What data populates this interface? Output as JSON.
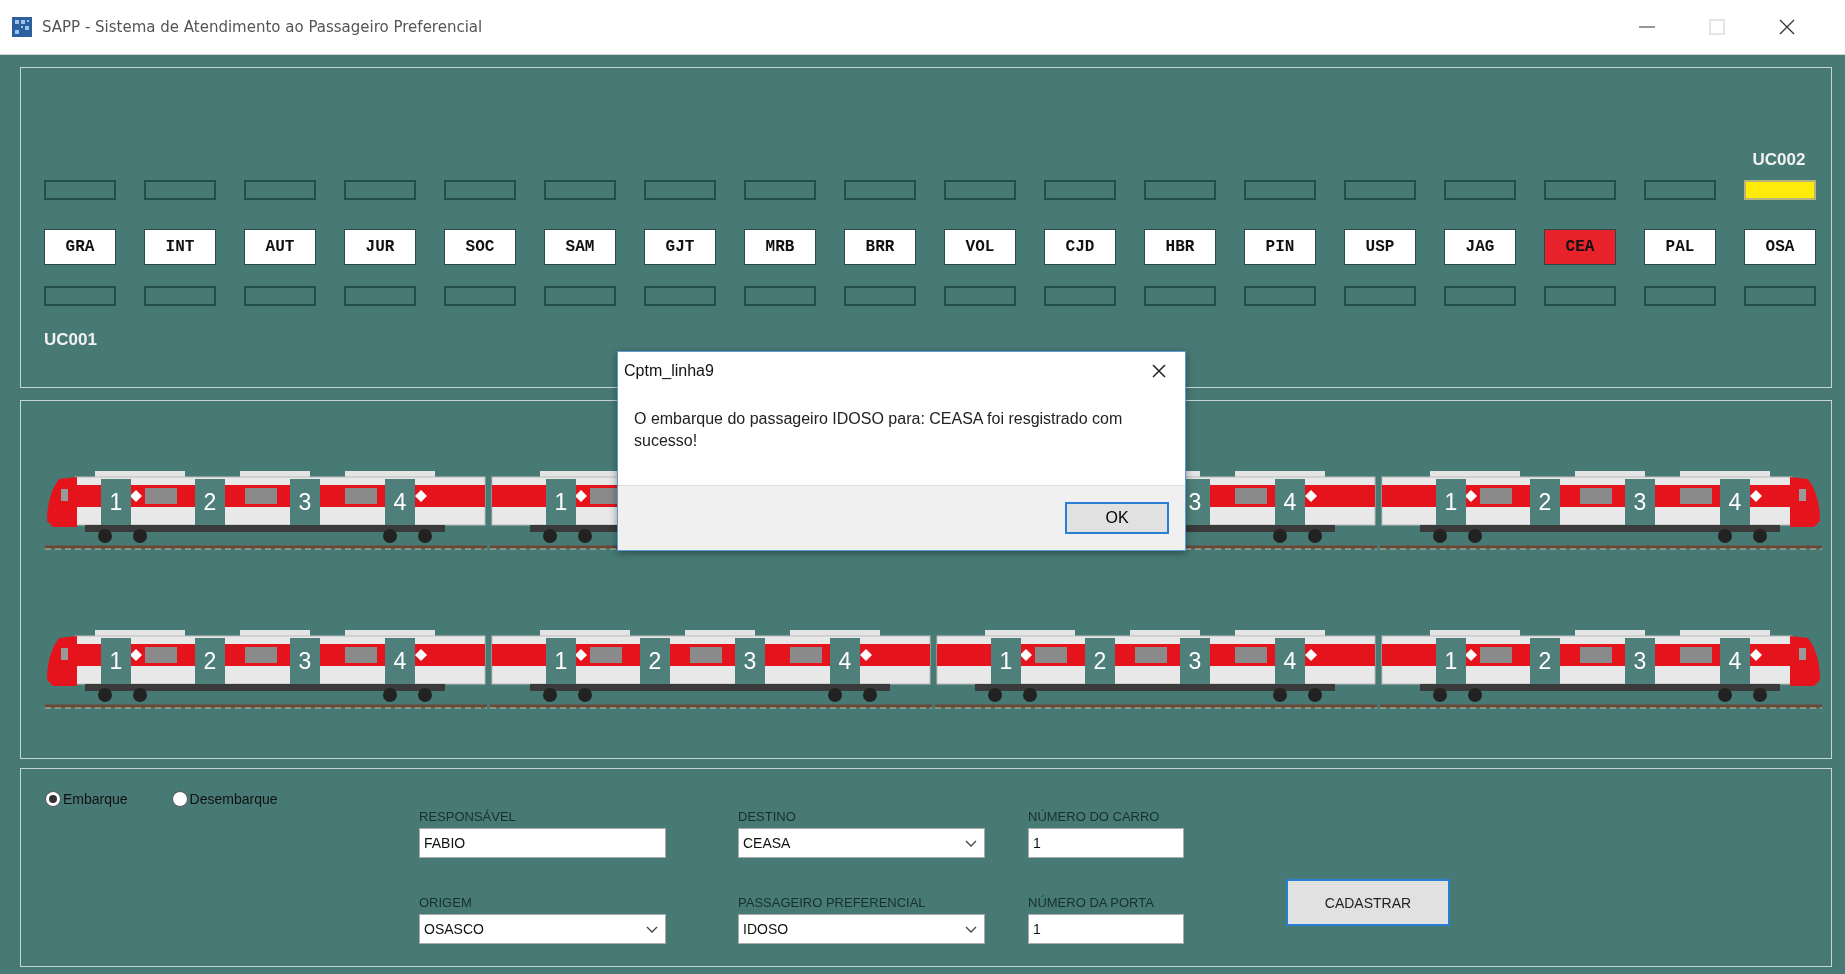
{
  "window": {
    "title": "SAPP - Sistema de Atendimento ao Passageiro Preferencial"
  },
  "line_panel": {
    "top_label": "UC002",
    "bottom_label": "UC001",
    "stations": [
      {
        "code": "GRA",
        "selected": false,
        "top_on": false,
        "bottom_on": false
      },
      {
        "code": "INT",
        "selected": false,
        "top_on": false,
        "bottom_on": false
      },
      {
        "code": "AUT",
        "selected": false,
        "top_on": false,
        "bottom_on": false
      },
      {
        "code": "JUR",
        "selected": false,
        "top_on": false,
        "bottom_on": false
      },
      {
        "code": "SOC",
        "selected": false,
        "top_on": false,
        "bottom_on": false
      },
      {
        "code": "SAM",
        "selected": false,
        "top_on": false,
        "bottom_on": false
      },
      {
        "code": "GJT",
        "selected": false,
        "top_on": false,
        "bottom_on": false
      },
      {
        "code": "MRB",
        "selected": false,
        "top_on": false,
        "bottom_on": false
      },
      {
        "code": "BRR",
        "selected": false,
        "top_on": false,
        "bottom_on": false
      },
      {
        "code": "VOL",
        "selected": false,
        "top_on": false,
        "bottom_on": false
      },
      {
        "code": "CJD",
        "selected": false,
        "top_on": false,
        "bottom_on": false
      },
      {
        "code": "HBR",
        "selected": false,
        "top_on": false,
        "bottom_on": false
      },
      {
        "code": "PIN",
        "selected": false,
        "top_on": false,
        "bottom_on": false
      },
      {
        "code": "USP",
        "selected": false,
        "top_on": false,
        "bottom_on": false
      },
      {
        "code": "JAG",
        "selected": false,
        "top_on": false,
        "bottom_on": false
      },
      {
        "code": "CEA",
        "selected": true,
        "top_on": false,
        "bottom_on": false
      },
      {
        "code": "PAL",
        "selected": false,
        "top_on": false,
        "bottom_on": false
      },
      {
        "code": "OSA",
        "selected": false,
        "top_on": true,
        "bottom_on": false
      }
    ]
  },
  "trains": [
    {
      "units": [
        {
          "kind": "full",
          "doors": [
            "1",
            "2",
            "3",
            "4"
          ]
        },
        {
          "kind": "left_visible",
          "doors": [
            "1"
          ]
        },
        {
          "kind": "right_visible",
          "doors": [
            "3",
            "4"
          ]
        },
        {
          "kind": "full",
          "doors": [
            "1",
            "2",
            "3",
            "4"
          ]
        }
      ]
    },
    {
      "units": [
        {
          "kind": "full",
          "doors": [
            "1",
            "2",
            "3",
            "4"
          ]
        },
        {
          "kind": "full",
          "doors": [
            "1",
            "2",
            "3",
            "4"
          ]
        },
        {
          "kind": "full",
          "doors": [
            "1",
            "2",
            "3",
            "4"
          ]
        },
        {
          "kind": "full",
          "doors": [
            "1",
            "2",
            "3",
            "4"
          ]
        }
      ]
    }
  ],
  "form": {
    "modes": [
      {
        "label": "Embarque",
        "selected": true
      },
      {
        "label": "Desembarque",
        "selected": false
      }
    ],
    "fields": [
      {
        "label": "RESPONSÁVEL",
        "value": "FABIO",
        "kind": "text"
      },
      {
        "label": "DESTINO",
        "value": "CEASA",
        "kind": "combo"
      },
      {
        "label": "NÚMERO DO CARRO",
        "value": "1",
        "kind": "text"
      },
      {
        "label": "ORIGEM",
        "value": "OSASCO",
        "kind": "combo"
      },
      {
        "label": "PASSAGEIRO PREFERENCIAL",
        "value": "IDOSO",
        "kind": "combo"
      },
      {
        "label": "NÚMERO DA PORTA",
        "value": "1",
        "kind": "text"
      }
    ],
    "submit": "CADASTRAR"
  },
  "dialog": {
    "title": "Cptm_linha9",
    "message": "O embarque do passageiro IDOSO para: CEASA foi resgistrado com sucesso!",
    "button": "OK"
  }
}
